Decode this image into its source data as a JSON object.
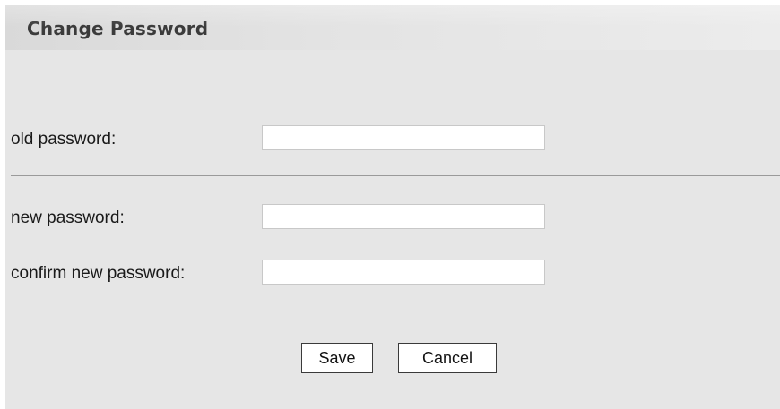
{
  "dialog": {
    "title": "Change Password"
  },
  "form": {
    "old_password": {
      "label": "old password:",
      "value": ""
    },
    "new_password": {
      "label": "new password:",
      "value": ""
    },
    "confirm_password": {
      "label": "confirm new password:",
      "value": ""
    }
  },
  "actions": {
    "save_label": "Save",
    "cancel_label": "Cancel"
  },
  "colors": {
    "panel_background": "#e6e6e6",
    "title_text": "#3b3b3b",
    "divider": "#9a9a9a"
  }
}
